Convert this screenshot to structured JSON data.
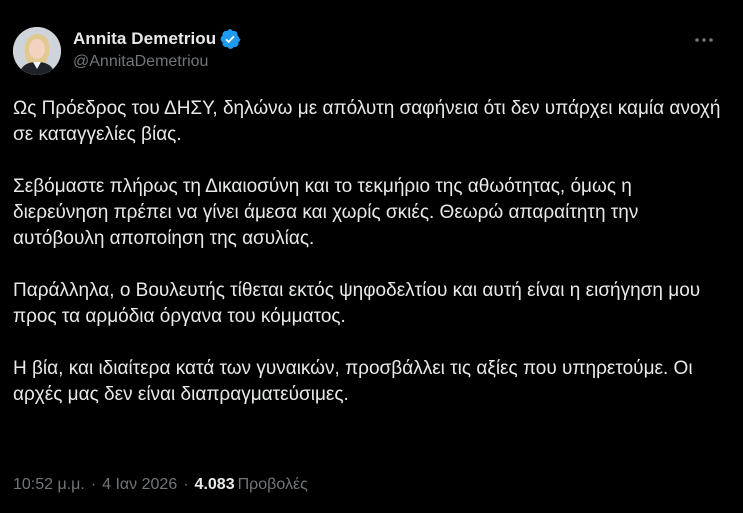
{
  "author": {
    "display_name": "Annita Demetriou",
    "handle": "@AnnitaDemetriou",
    "verified": true,
    "verified_color": "#1d9bf0"
  },
  "tweet": {
    "paragraphs": [
      "Ως Πρόεδρος του ΔΗΣΥ, δηλώνω με απόλυτη σαφήνεια ότι δεν υπάρχει καμία ανοχή σε καταγγελίες βίας.",
      "Σεβόμαστε πλήρως τη Δικαιοσύνη και το τεκμήριο της αθωότητας, όμως η διερεύνηση πρέπει να γίνει άμεσα και χωρίς σκιές. Θεωρώ απαραίτητη την αυτόβουλη αποποίηση της ασυλίας.",
      "Παράλληλα, ο Βουλευτής τίθεται εκτός ψηφοδελτίου και αυτή είναι η εισήγηση μου προς τα αρμόδια όργανα του κόμματος.",
      "Η βία, και ιδιαίτερα κατά των γυναικών, προσβάλλει τις αξίες που υπηρετούμε. Οι αρχές μας δεν είναι διαπραγματεύσιμες."
    ]
  },
  "meta": {
    "time": "10:52 μ.μ.",
    "separator": "·",
    "date": "4 Ιαν 2026",
    "views_count": "4.083",
    "views_label": "Προβολές"
  },
  "icons": {
    "avatar": "profile-photo",
    "verified": "verified-badge-icon",
    "more": "more-options-icon"
  },
  "colors": {
    "background": "#000000",
    "text_primary": "#e7e9ea",
    "text_secondary": "#71767b"
  }
}
